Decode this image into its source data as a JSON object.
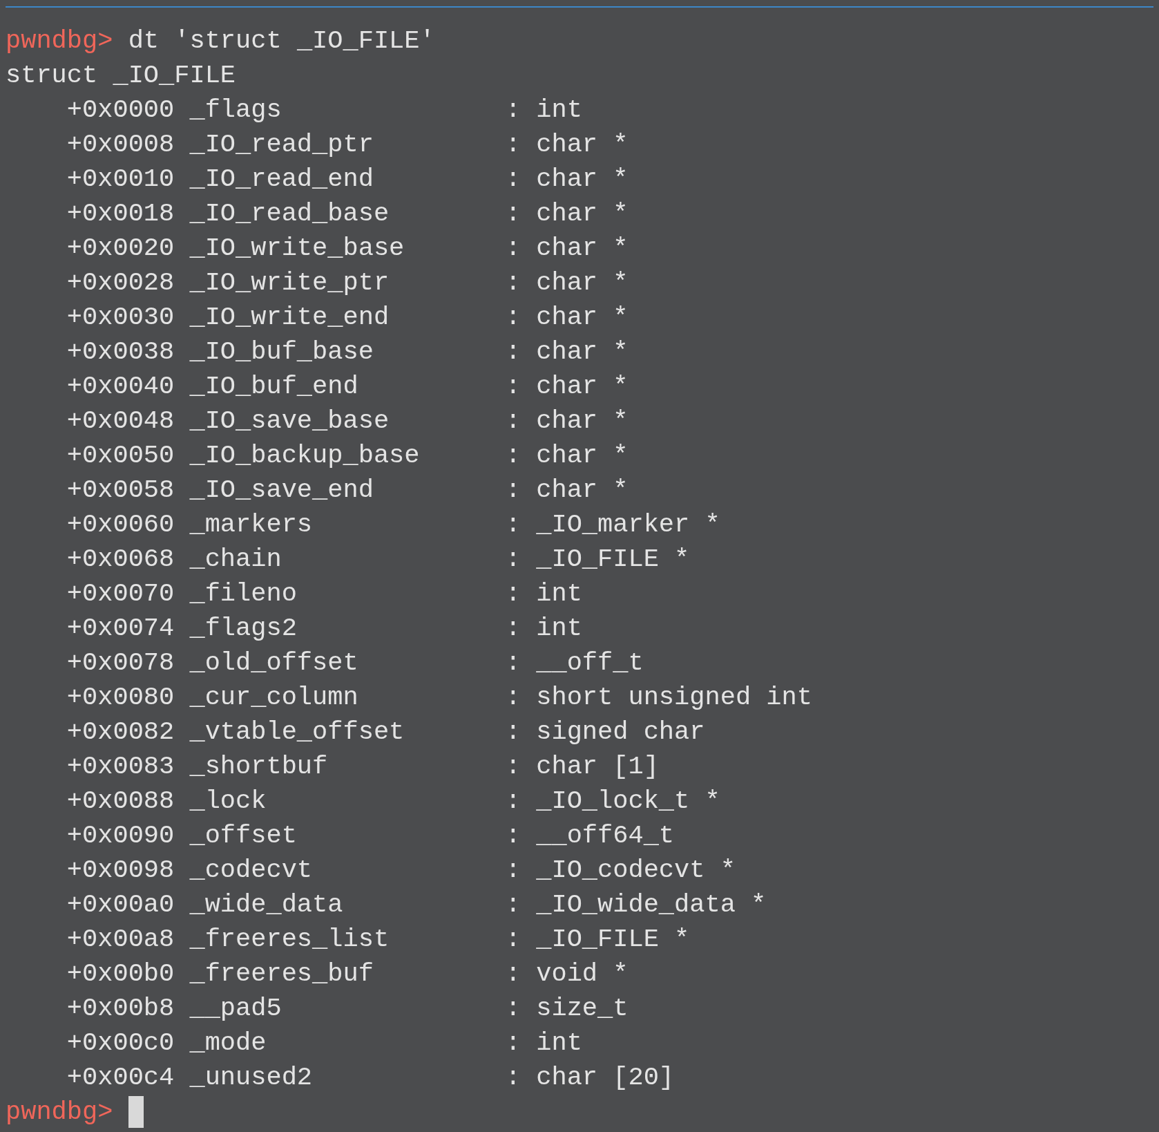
{
  "command": {
    "prompt": "pwndbg>",
    "text": "dt 'struct _IO_FILE'"
  },
  "header": "struct _IO_FILE",
  "fields": [
    {
      "offset": "+0x0000",
      "name": "_flags",
      "sep": ":",
      "type": "int"
    },
    {
      "offset": "+0x0008",
      "name": "_IO_read_ptr",
      "sep": ":",
      "type": "char *"
    },
    {
      "offset": "+0x0010",
      "name": "_IO_read_end",
      "sep": ":",
      "type": "char *"
    },
    {
      "offset": "+0x0018",
      "name": "_IO_read_base",
      "sep": ":",
      "type": "char *"
    },
    {
      "offset": "+0x0020",
      "name": "_IO_write_base",
      "sep": ":",
      "type": "char *"
    },
    {
      "offset": "+0x0028",
      "name": "_IO_write_ptr",
      "sep": ":",
      "type": "char *"
    },
    {
      "offset": "+0x0030",
      "name": "_IO_write_end",
      "sep": ":",
      "type": "char *"
    },
    {
      "offset": "+0x0038",
      "name": "_IO_buf_base",
      "sep": ":",
      "type": "char *"
    },
    {
      "offset": "+0x0040",
      "name": "_IO_buf_end",
      "sep": ":",
      "type": "char *"
    },
    {
      "offset": "+0x0048",
      "name": "_IO_save_base",
      "sep": ":",
      "type": "char *"
    },
    {
      "offset": "+0x0050",
      "name": "_IO_backup_base",
      "sep": ":",
      "type": "char *"
    },
    {
      "offset": "+0x0058",
      "name": "_IO_save_end",
      "sep": ":",
      "type": "char *"
    },
    {
      "offset": "+0x0060",
      "name": "_markers",
      "sep": ":",
      "type": "_IO_marker *"
    },
    {
      "offset": "+0x0068",
      "name": "_chain",
      "sep": ":",
      "type": "_IO_FILE *"
    },
    {
      "offset": "+0x0070",
      "name": "_fileno",
      "sep": ":",
      "type": "int"
    },
    {
      "offset": "+0x0074",
      "name": "_flags2",
      "sep": ":",
      "type": "int"
    },
    {
      "offset": "+0x0078",
      "name": "_old_offset",
      "sep": ":",
      "type": "__off_t"
    },
    {
      "offset": "+0x0080",
      "name": "_cur_column",
      "sep": ":",
      "type": "short unsigned int"
    },
    {
      "offset": "+0x0082",
      "name": "_vtable_offset",
      "sep": ":",
      "type": "signed char"
    },
    {
      "offset": "+0x0083",
      "name": "_shortbuf",
      "sep": ":",
      "type": "char [1]"
    },
    {
      "offset": "+0x0088",
      "name": "_lock",
      "sep": ":",
      "type": "_IO_lock_t *"
    },
    {
      "offset": "+0x0090",
      "name": "_offset",
      "sep": ":",
      "type": "__off64_t"
    },
    {
      "offset": "+0x0098",
      "name": "_codecvt",
      "sep": ":",
      "type": "_IO_codecvt *"
    },
    {
      "offset": "+0x00a0",
      "name": "_wide_data",
      "sep": ":",
      "type": "_IO_wide_data *"
    },
    {
      "offset": "+0x00a8",
      "name": "_freeres_list",
      "sep": ":",
      "type": "_IO_FILE *"
    },
    {
      "offset": "+0x00b0",
      "name": "_freeres_buf",
      "sep": ":",
      "type": "void *"
    },
    {
      "offset": "+0x00b8",
      "name": "__pad5",
      "sep": ":",
      "type": "size_t"
    },
    {
      "offset": "+0x00c0",
      "name": "_mode",
      "sep": ":",
      "type": "int"
    },
    {
      "offset": "+0x00c4",
      "name": "_unused2",
      "sep": ":",
      "type": "char [20]"
    }
  ],
  "prompt": {
    "prompt": "pwndbg>"
  }
}
